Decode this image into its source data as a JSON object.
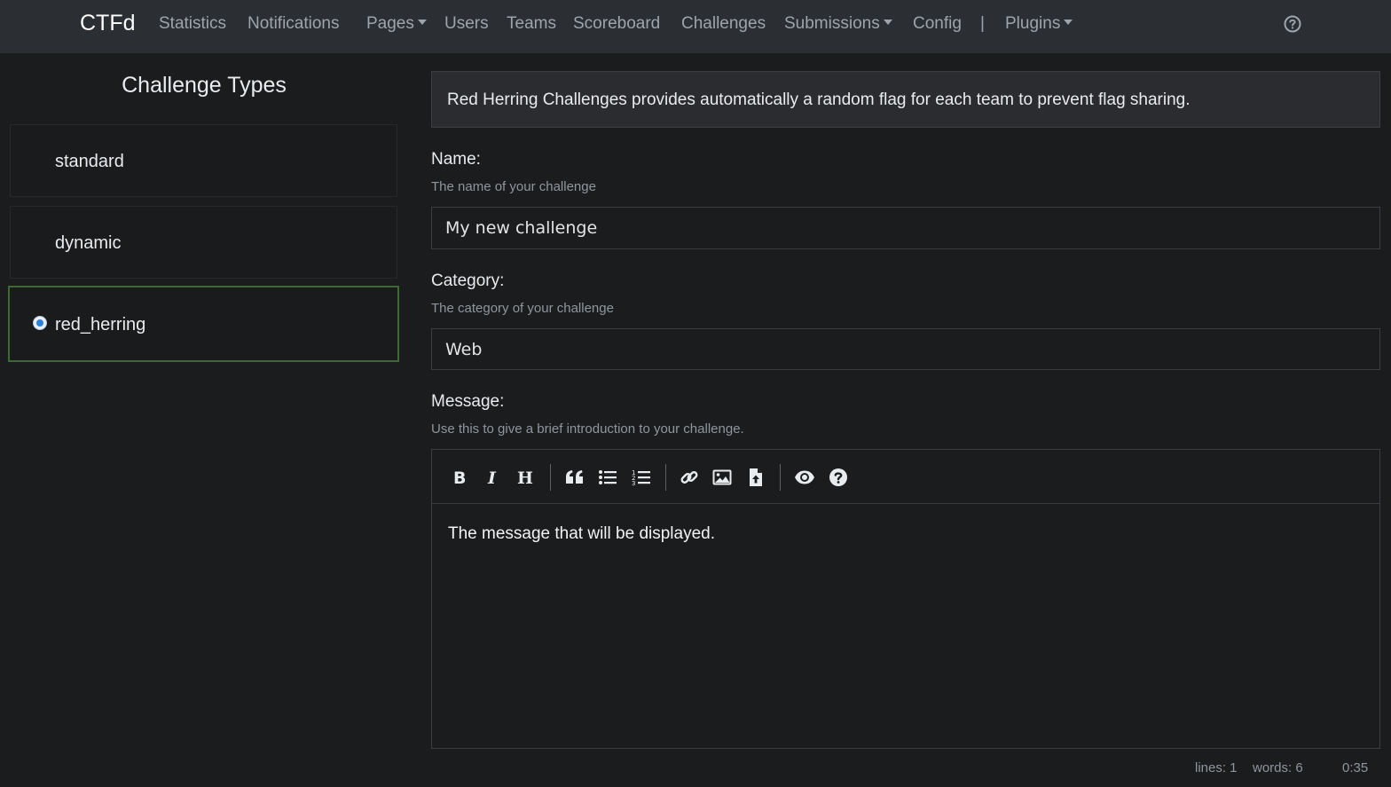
{
  "navbar": {
    "brand": "CTFd",
    "links": [
      {
        "label": "Statistics"
      },
      {
        "label": "Notifications"
      },
      {
        "label": "Pages"
      },
      {
        "label": "Users"
      },
      {
        "label": "Teams"
      },
      {
        "label": "Scoreboard"
      },
      {
        "label": "Challenges"
      },
      {
        "label": "Submissions"
      },
      {
        "label": "Config"
      },
      {
        "label": "Plugins"
      }
    ],
    "separator": "|",
    "help_icon": "question-circle-icon"
  },
  "sidebar": {
    "title": "Challenge Types",
    "types": [
      {
        "label": "standard",
        "selected": false
      },
      {
        "label": "dynamic",
        "selected": false
      },
      {
        "label": "red_herring",
        "selected": true
      }
    ]
  },
  "form": {
    "description": "Red Herring Challenges provides automatically a random flag for each team to prevent flag sharing.",
    "name": {
      "label": "Name:",
      "help": "The name of your challenge",
      "value": "My new challenge"
    },
    "category": {
      "label": "Category:",
      "help": "The category of your challenge",
      "value": "Web"
    },
    "message": {
      "label": "Message:",
      "help": "Use this to give a brief introduction to your challenge.",
      "content": "The message that will be displayed.",
      "toolbar": [
        "bold-icon",
        "italic-icon",
        "heading-icon",
        "quote-icon",
        "unordered-list-icon",
        "ordered-list-icon",
        "link-icon",
        "image-icon",
        "upload-file-icon",
        "preview-eye-icon",
        "guide-question-icon"
      ]
    }
  },
  "status_bar": {
    "lines": "lines: 1",
    "words": "words: 6",
    "time": "0:35"
  },
  "colors": {
    "background": "#1b1c1e",
    "navbar": "#2b2f33",
    "selected_border": "#3b6b2e",
    "radio_accent": "#2f80d8"
  }
}
